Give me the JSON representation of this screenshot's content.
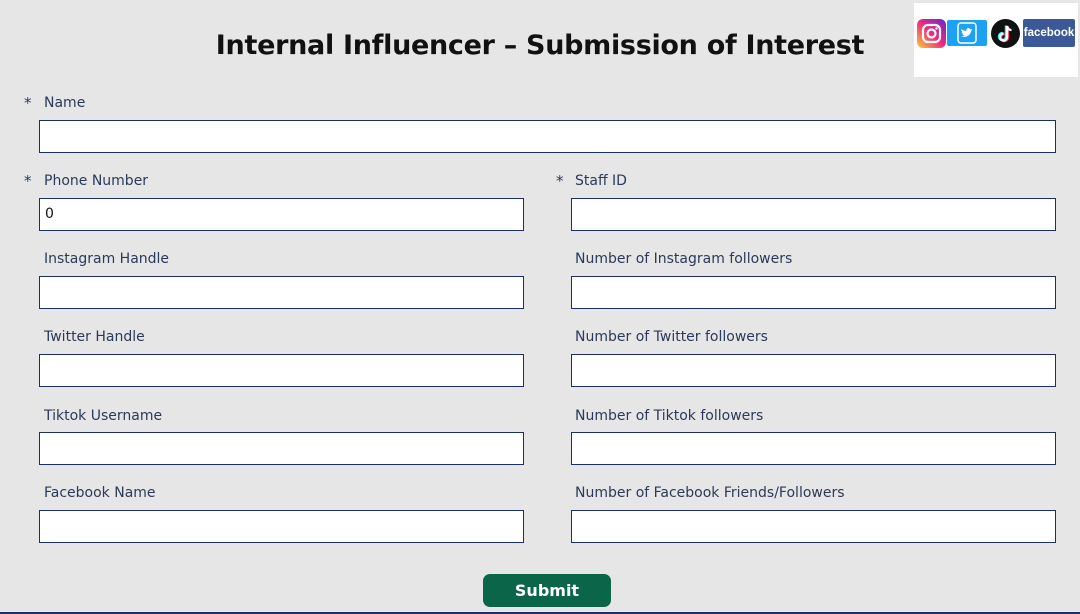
{
  "title": "Internal Influencer – Submission of Interest",
  "logos": {
    "instagram": "instagram-logo",
    "twitter": "twitter-logo",
    "tiktok": "tiktok-logo",
    "facebook_text": "facebook"
  },
  "required_marker": "*",
  "fields": {
    "name": {
      "label": "Name",
      "value": ""
    },
    "phone": {
      "label": "Phone Number",
      "value": "0"
    },
    "staff_id": {
      "label": "Staff ID",
      "value": ""
    },
    "instagram_handle": {
      "label": "Instagram Handle",
      "value": ""
    },
    "instagram_followers": {
      "label": "Number of Instagram followers",
      "value": ""
    },
    "twitter_handle": {
      "label": "Twitter Handle",
      "value": ""
    },
    "twitter_followers": {
      "label": "Number of Twitter followers",
      "value": ""
    },
    "tiktok_username": {
      "label": "Tiktok Username",
      "value": ""
    },
    "tiktok_followers": {
      "label": "Number of Tiktok followers",
      "value": ""
    },
    "facebook_name": {
      "label": "Facebook Name",
      "value": ""
    },
    "facebook_followers": {
      "label": "Number of Facebook Friends/Followers",
      "value": ""
    }
  },
  "submit_label": "Submit",
  "colors": {
    "background": "#e6e6e6",
    "input_border": "#1e2d6b",
    "label_text": "#2b3a5a",
    "submit_bg": "#0b6649"
  }
}
